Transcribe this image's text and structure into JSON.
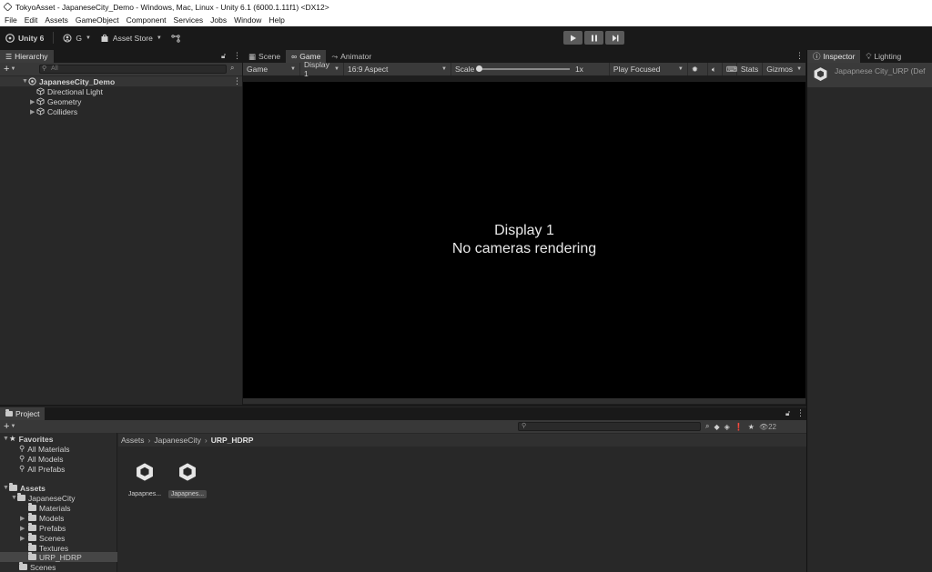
{
  "window": {
    "title": "TokyoAsset - JapaneseCity_Demo - Windows, Mac, Linux - Unity 6.1 (6000.1.11f1) <DX12>"
  },
  "menu": [
    "File",
    "Edit",
    "Assets",
    "GameObject",
    "Component",
    "Services",
    "Jobs",
    "Window",
    "Help"
  ],
  "toolbar": {
    "unity_label": "Unity 6",
    "account_label": "G",
    "asset_store_label": "Asset Store"
  },
  "hierarchy": {
    "tab_label": "Hierarchy",
    "add_label": "+",
    "search_placeholder": "All",
    "scene_name": "JapaneseCity_Demo",
    "items": [
      {
        "label": "Directional Light"
      },
      {
        "label": "Geometry"
      },
      {
        "label": "Colliders"
      }
    ]
  },
  "center_tabs": [
    {
      "label": "Scene"
    },
    {
      "label": "Game"
    },
    {
      "label": "Animator"
    }
  ],
  "game_toolbar": {
    "mode": "Game",
    "display": "Display 1",
    "aspect": "16:9 Aspect",
    "scale_label": "Scale",
    "scale_value": "1x",
    "scale_level": 0.0,
    "play_focused": "Play Focused",
    "stats": "Stats",
    "gizmos": "Gizmos"
  },
  "game_view": {
    "line1": "Display 1",
    "line2": "No cameras rendering"
  },
  "inspector": {
    "tabs": [
      {
        "label": "Inspector"
      },
      {
        "label": "Lighting"
      }
    ],
    "object_name": "Japapnese City_URP (Def"
  },
  "project": {
    "tab_label": "Project",
    "add_label": "+",
    "hidden_count": "22",
    "favorites": {
      "label": "Favorites",
      "items": [
        {
          "label": "All Materials"
        },
        {
          "label": "All Models"
        },
        {
          "label": "All Prefabs"
        }
      ]
    },
    "assets_label": "Assets",
    "japanese_city_label": "JapaneseCity",
    "folders": [
      {
        "label": "Materials"
      },
      {
        "label": "Models"
      },
      {
        "label": "Prefabs"
      },
      {
        "label": "Scenes"
      },
      {
        "label": "Textures"
      },
      {
        "label": "URP_HDRP"
      }
    ],
    "root_scenes_label": "Scenes",
    "breadcrumb": [
      "Assets",
      "JapaneseCity",
      "URP_HDRP"
    ],
    "assets": [
      {
        "label": "Japapnes..."
      },
      {
        "label": "Japapnes..."
      }
    ]
  }
}
